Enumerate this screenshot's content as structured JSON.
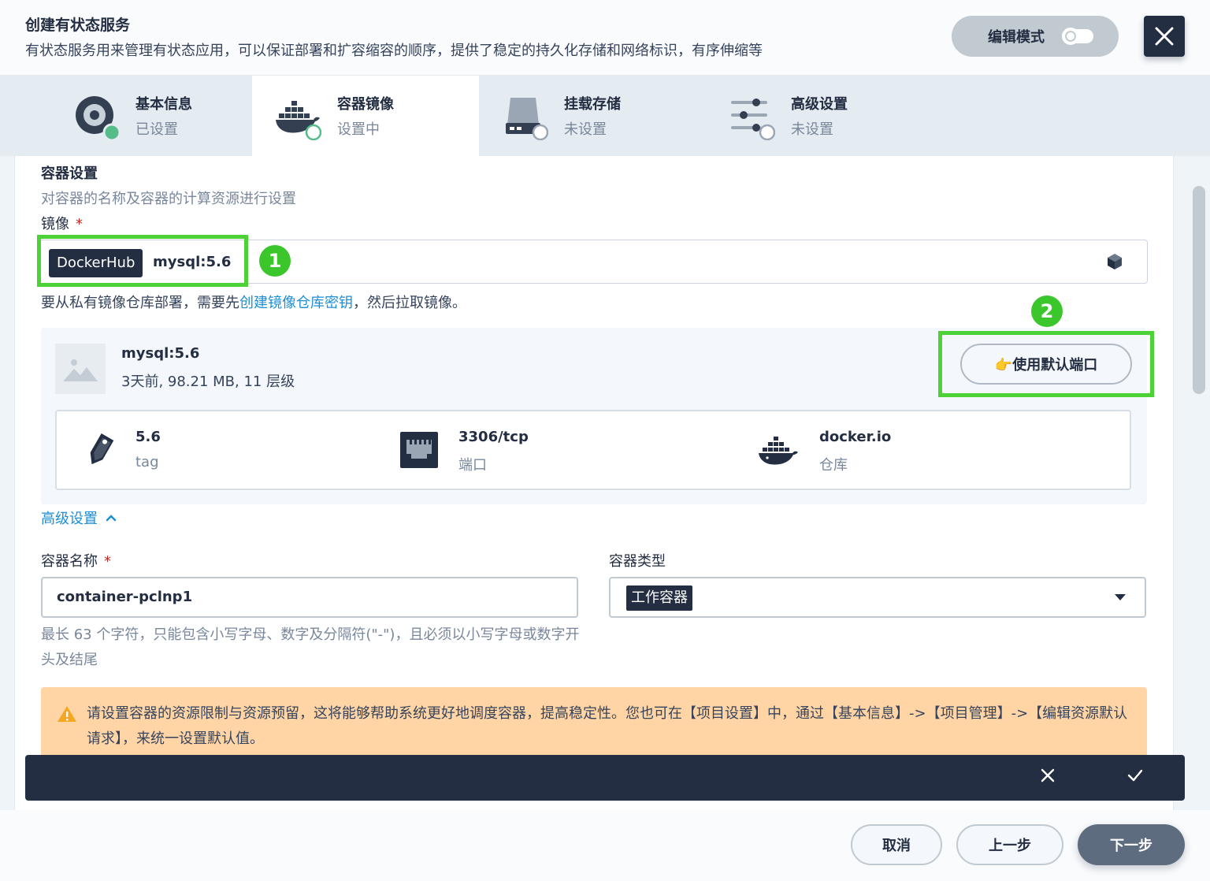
{
  "header": {
    "title": "创建有状态服务",
    "description": "有状态服务用来管理有状态应用，可以保证部署和扩容缩容的顺序，提供了稳定的持久化存储和网络标识，有序伸缩等",
    "edit_mode_label": "编辑模式"
  },
  "steps": [
    {
      "title": "基本信息",
      "status": "已设置"
    },
    {
      "title": "容器镜像",
      "status": "设置中"
    },
    {
      "title": "挂载存储",
      "status": "未设置"
    },
    {
      "title": "高级设置",
      "status": "未设置"
    }
  ],
  "container_settings": {
    "title": "容器设置",
    "description": "对容器的名称及容器的计算资源进行设置",
    "image_label": "镜像",
    "required_mark": "*",
    "registry_badge": "DockerHub",
    "image_value": "mysql:5.6",
    "hint_prefix": "要从私有镜像仓库部署，需要先",
    "hint_link": "创建镜像仓库密钥",
    "hint_suffix": "，然后拉取镜像。"
  },
  "annotations": {
    "one": "1",
    "two": "2"
  },
  "image_card": {
    "name": "mysql:5.6",
    "meta": "3天前, 98.21 MB, 11 层级",
    "use_default_port": "👉使用默认端口",
    "tag_value": "5.6",
    "tag_label": "tag",
    "port_value": "3306/tcp",
    "port_label": "端口",
    "registry_value": "docker.io",
    "registry_label": "仓库"
  },
  "advanced_toggle": "高级设置",
  "form": {
    "name_label": "容器名称",
    "name_value": "container-pclnp1",
    "name_rule": "最长 63 个字符，只能包含小写字母、数字及分隔符(\"-\")，且必须以小写字母或数字开头及结尾",
    "type_label": "容器类型",
    "type_value": "工作容器"
  },
  "warning": {
    "text": "请设置容器的资源限制与资源预留，这将能够帮助系统更好地调度容器，提高稳定性。您也可在【项目设置】中，通过【基本信息】->【项目管理】->【编辑资源默认请求】，来统一设置默认值。"
  },
  "footer": {
    "cancel": "取消",
    "previous": "上一步",
    "next": "下一步"
  },
  "colors": {
    "dark": "#242e42",
    "link": "#1d8ed6",
    "highlight": "#4cd137",
    "success": "#55bc8a",
    "warning_bg": "#ffd5a6"
  }
}
